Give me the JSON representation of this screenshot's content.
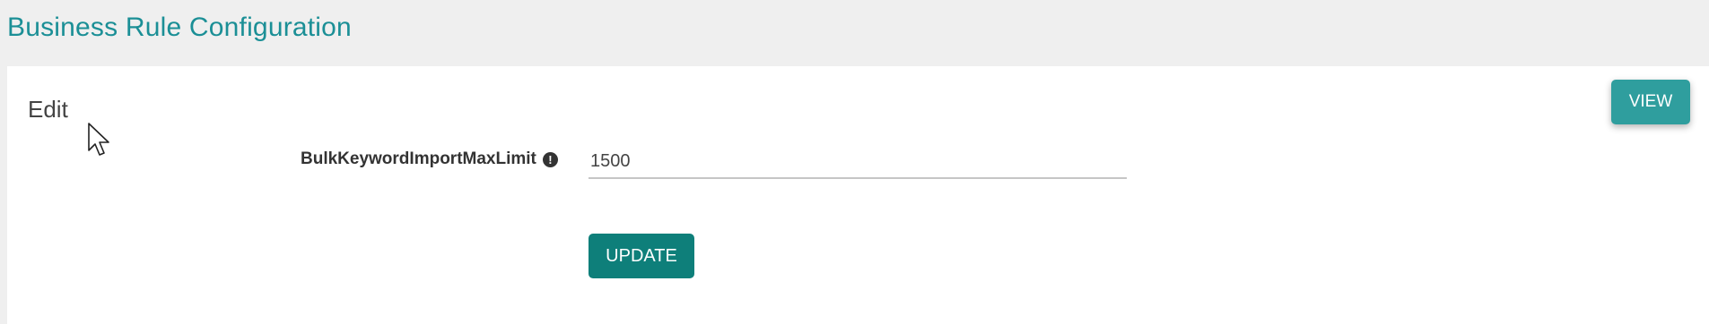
{
  "header": {
    "title": "Business Rule Configuration"
  },
  "panel": {
    "section_title": "Edit",
    "view_label": "VIEW",
    "field": {
      "label": "BulkKeywordImportMaxLimit",
      "info_icon": "!",
      "value": "1500"
    },
    "update_label": "UPDATE"
  },
  "colors": {
    "title": "#1b8f96",
    "view_button": "#2f9e9e",
    "update_button": "#0e7f7a",
    "header_background": "#efefef"
  }
}
